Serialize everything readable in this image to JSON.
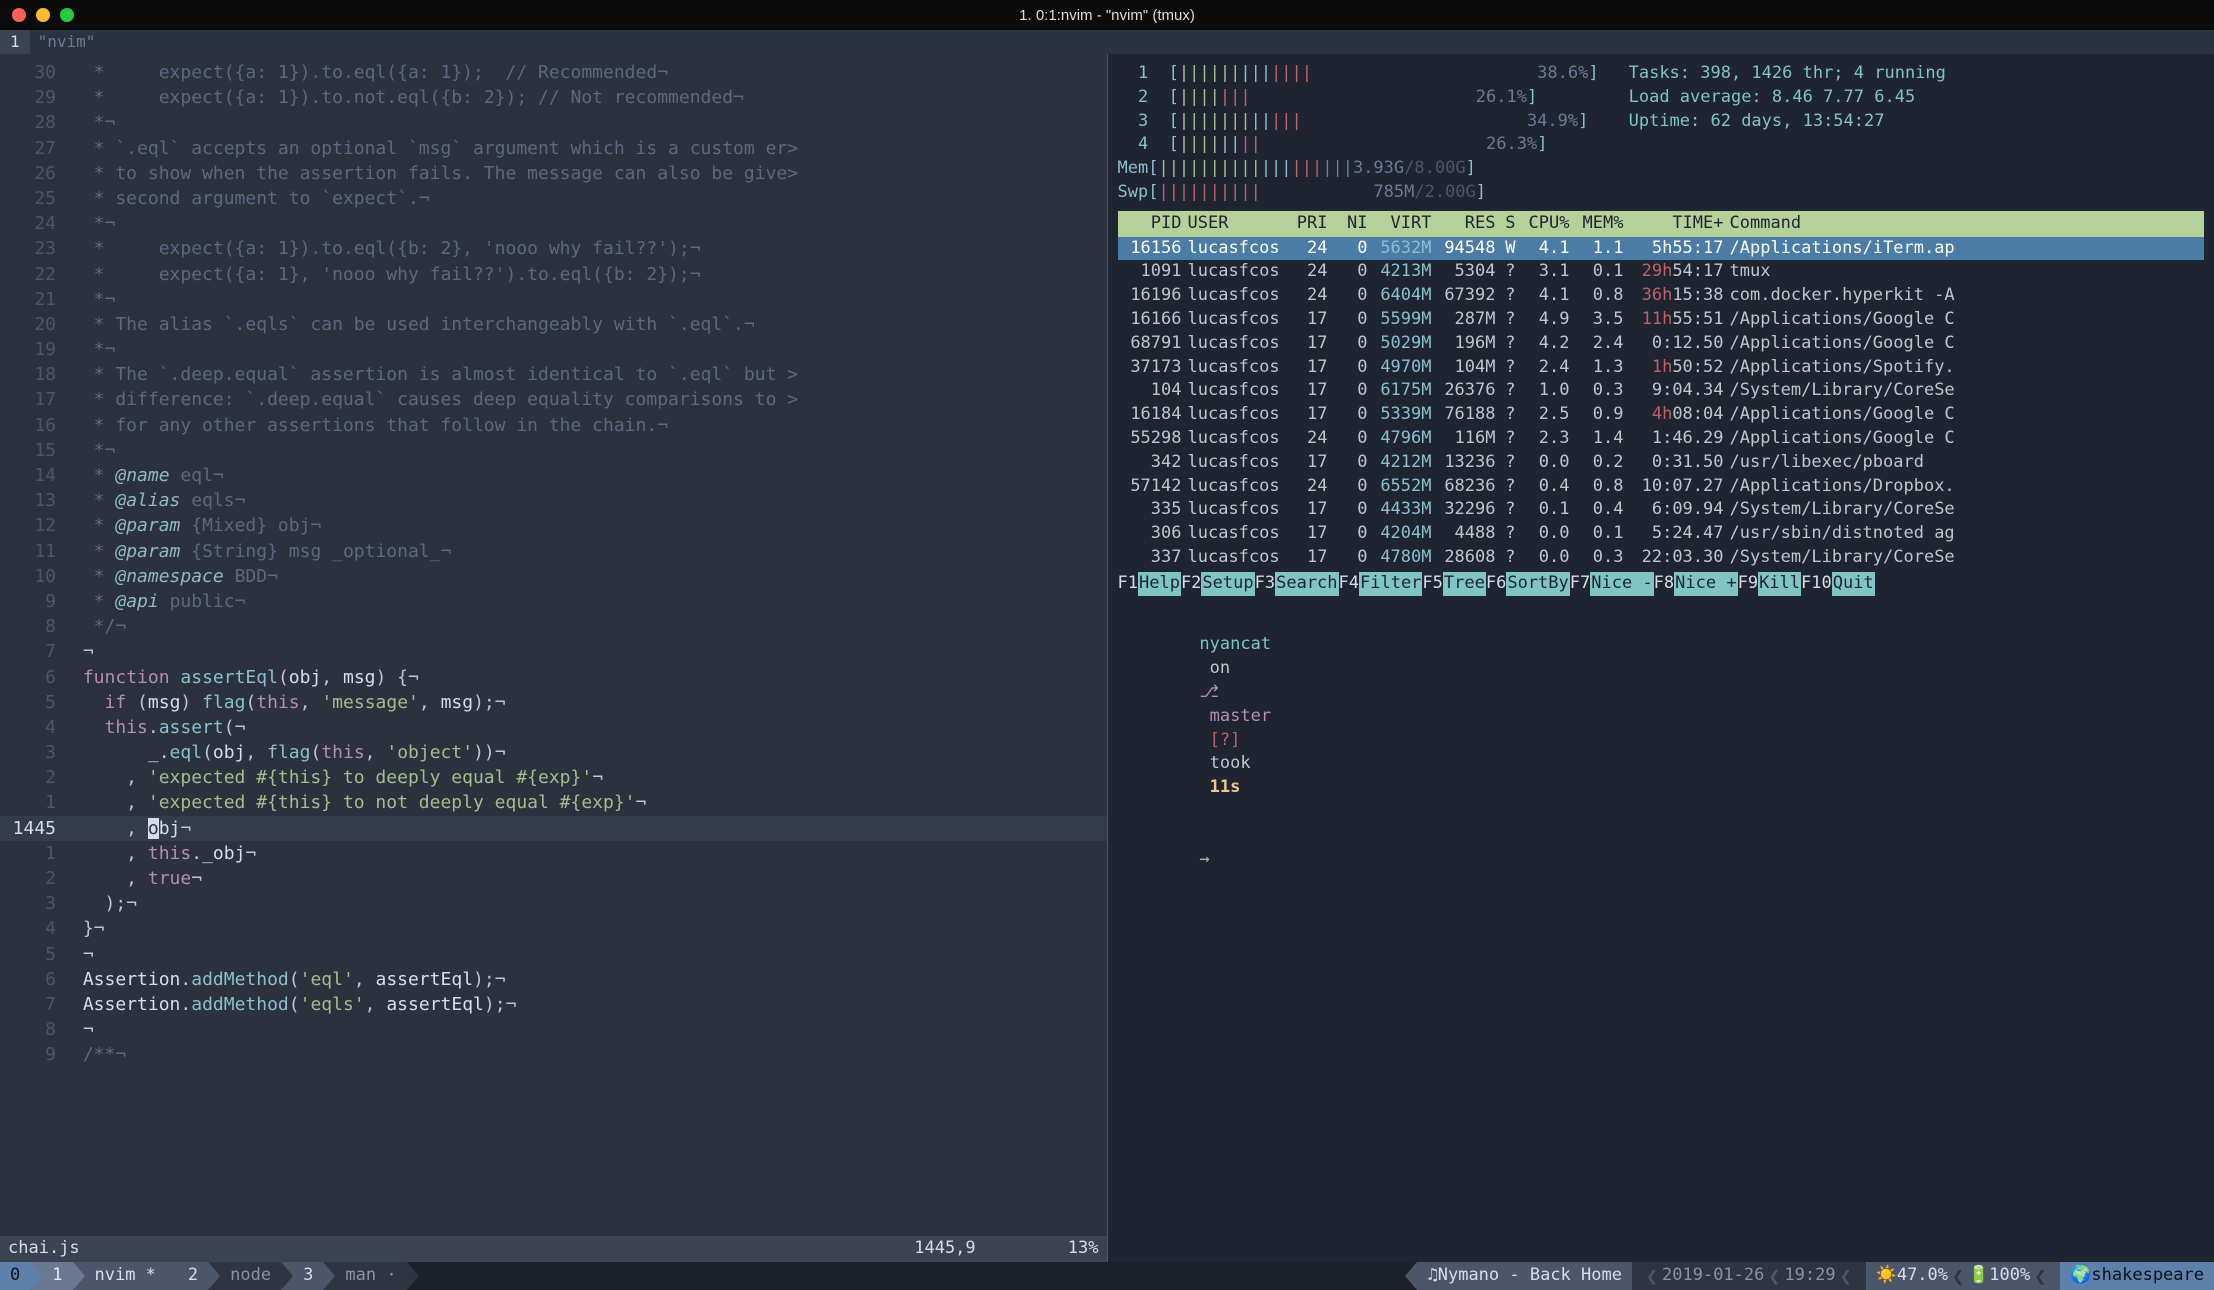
{
  "window": {
    "title": "1. 0:1:nvim - \"nvim\" (tmux)"
  },
  "tmux_tabs": {
    "index": "1",
    "label": "\"nvim\""
  },
  "editor": {
    "filename": "chai.js",
    "cursor_pos": "1445,9",
    "scroll_pct": "13%",
    "current_line_number": "1445",
    "lines": [
      {
        "n": "30",
        "cls": "dim",
        "html": "  *     expect({a: 1}).to.eql({a: 1});  // Recommended¬"
      },
      {
        "n": "29",
        "cls": "dim",
        "html": "  *     expect({a: 1}).to.not.eql({b: 2}); // Not recommended¬"
      },
      {
        "n": "28",
        "cls": "dim",
        "html": "  *¬"
      },
      {
        "n": "27",
        "cls": "dim",
        "html": "  * `.eql` accepts an optional `msg` argument which is a custom er>"
      },
      {
        "n": "26",
        "cls": "dim",
        "html": "  * to show when the assertion fails. The message can also be give>"
      },
      {
        "n": "25",
        "cls": "dim",
        "html": "  * second argument to `expect`.¬"
      },
      {
        "n": "24",
        "cls": "dim",
        "html": "  *¬"
      },
      {
        "n": "23",
        "cls": "dim",
        "html": "  *     expect({a: 1}).to.eql({b: 2}, 'nooo why fail??');¬"
      },
      {
        "n": "22",
        "cls": "dim",
        "html": "  *     expect({a: 1}, 'nooo why fail??').to.eql({b: 2});¬"
      },
      {
        "n": "21",
        "cls": "dim",
        "html": "  *¬"
      },
      {
        "n": "20",
        "cls": "dim",
        "html": "  * The alias `.eqls` can be used interchangeably with `.eql`.¬"
      },
      {
        "n": "19",
        "cls": "dim",
        "html": "  *¬"
      },
      {
        "n": "18",
        "cls": "dim",
        "html": "  * The `.deep.equal` assertion is almost identical to `.eql` but >"
      },
      {
        "n": "17",
        "cls": "dim",
        "html": "  * difference: `.deep.equal` causes deep equality comparisons to >"
      },
      {
        "n": "16",
        "cls": "dim",
        "html": "  * for any other assertions that follow in the chain.¬"
      },
      {
        "n": "15",
        "cls": "dim",
        "html": "  *¬"
      },
      {
        "n": "14",
        "cls": "tag",
        "html": "  * <span class='c-tag'>@name</span> <span class='c-dim'>eql</span>¬"
      },
      {
        "n": "13",
        "cls": "tag",
        "html": "  * <span class='c-tag'>@alias</span> <span class='c-dim'>eqls</span>¬"
      },
      {
        "n": "12",
        "cls": "tag",
        "html": "  * <span class='c-tag'>@param</span> <span class='c-dim'>{Mixed} obj</span>¬"
      },
      {
        "n": "11",
        "cls": "tag",
        "html": "  * <span class='c-tag'>@param</span> <span class='c-dim'>{String} msg _optional_</span>¬"
      },
      {
        "n": "10",
        "cls": "tag",
        "html": "  * <span class='c-tag'>@namespace</span> <span class='c-dim'>BDD</span>¬"
      },
      {
        "n": "9",
        "cls": "tag",
        "html": "  * <span class='c-tag'>@api</span> <span class='c-dim'>public</span>¬"
      },
      {
        "n": "8",
        "cls": "dim",
        "html": "  */¬"
      },
      {
        "n": "7",
        "cls": "code",
        "html": " ¬"
      },
      {
        "n": "6",
        "cls": "code",
        "html": " <span class='c-keyword'>function</span> <span class='c-func'>assertEql</span>(<span class='c-ident'>obj</span>, <span class='c-ident'>msg</span>) {¬"
      },
      {
        "n": "5",
        "cls": "code",
        "html": "   <span class='c-keyword'>if</span> (<span class='c-ident'>msg</span>) <span class='c-func'>flag</span>(<span class='c-keyword'>this</span>, <span class='c-string'>'message'</span>, <span class='c-ident'>msg</span>);¬"
      },
      {
        "n": "4",
        "cls": "code",
        "html": "   <span class='c-keyword'>this</span>.<span class='c-func'>assert</span>(¬"
      },
      {
        "n": "3",
        "cls": "code",
        "html": "       <span class='c-ident'>_</span>.<span class='c-func'>eql</span>(<span class='c-ident'>obj</span>, <span class='c-func'>flag</span>(<span class='c-keyword'>this</span>, <span class='c-string'>'object'</span>))¬"
      },
      {
        "n": "2",
        "cls": "code",
        "html": "     , <span class='c-string'>'expected #{this} to deeply equal #{exp}'</span>¬"
      },
      {
        "n": "1",
        "cls": "code",
        "html": "     , <span class='c-string'>'expected #{this} to not deeply equal #{exp}'</span>¬"
      },
      {
        "n": "1445",
        "cls": "cur",
        "html": "     , <span class='cursor-cell'>o</span><span class='c-ident'>bj</span>¬"
      },
      {
        "n": "1",
        "cls": "code",
        "html": "     , <span class='c-keyword'>this</span>.<span class='c-ident'>_obj</span>¬"
      },
      {
        "n": "2",
        "cls": "code",
        "html": "     , <span class='c-keyword'>true</span>¬"
      },
      {
        "n": "3",
        "cls": "code",
        "html": "   );¬"
      },
      {
        "n": "4",
        "cls": "code",
        "html": " }¬"
      },
      {
        "n": "5",
        "cls": "code",
        "html": " ¬"
      },
      {
        "n": "6",
        "cls": "code",
        "html": " <span class='c-ident'>Assertion</span>.<span class='c-func'>addMethod</span>(<span class='c-string'>'eql'</span>, <span class='c-ident'>assertEql</span>);¬"
      },
      {
        "n": "7",
        "cls": "code",
        "html": " <span class='c-ident'>Assertion</span>.<span class='c-func'>addMethod</span>(<span class='c-string'>'eqls'</span>, <span class='c-ident'>assertEql</span>);¬"
      },
      {
        "n": "8",
        "cls": "code",
        "html": " ¬"
      },
      {
        "n": "9",
        "cls": "dim",
        "html": " /**¬"
      }
    ]
  },
  "htop": {
    "cpus": [
      {
        "label": "1",
        "pct": "38.6%"
      },
      {
        "label": "2",
        "pct": "26.1%"
      },
      {
        "label": "3",
        "pct": "34.9%"
      },
      {
        "label": "4",
        "pct": "26.3%"
      }
    ],
    "mem": {
      "label": "Mem",
      "used": "3.93G",
      "total": "8.00G"
    },
    "swp": {
      "label": "Swp",
      "used": "785M",
      "total": "2.00G"
    },
    "tasks": "Tasks: 398, 1426 thr; 4 running",
    "load": "Load average: 8.46 7.77 6.45",
    "uptime": "Uptime: 62 days, 13:54:27",
    "headers": {
      "PID": "PID",
      "USER": "USER",
      "PRI": "PRI",
      "NI": "NI",
      "VIRT": "VIRT",
      "RES": "RES",
      "S": "S",
      "CPU": "CPU%",
      "MEM": "MEM%",
      "TIME": "TIME+",
      "CMD": "Command"
    },
    "rows": [
      {
        "sel": true,
        "PID": "16156",
        "USER": "lucasfcos",
        "PRI": "24",
        "NI": "0",
        "VIRT": "5632M",
        "RES": "94548",
        "S": "W",
        "CPU": "4.1",
        "MEM": "1.1",
        "TIMEh": "5h",
        "TIMEr": "55:17",
        "CMD": "/Applications/iTerm.ap"
      },
      {
        "PID": "1091",
        "USER": "lucasfcos",
        "PRI": "24",
        "NI": "0",
        "VIRT": "4213M",
        "RES": "5304",
        "S": "?",
        "CPU": "3.1",
        "MEM": "0.1",
        "TIMEh": "29h",
        "TIMEr": "54:17",
        "thl": "red",
        "CMD": "tmux"
      },
      {
        "PID": "16196",
        "USER": "lucasfcos",
        "PRI": "24",
        "NI": "0",
        "VIRT": "6404M",
        "RES": "67392",
        "S": "?",
        "CPU": "4.1",
        "MEM": "0.8",
        "TIMEh": "36h",
        "TIMEr": "15:38",
        "thl": "red",
        "CMD": "com.docker.hyperkit -A"
      },
      {
        "PID": "16166",
        "USER": "lucasfcos",
        "PRI": "17",
        "NI": "0",
        "VIRT": "5599M",
        "RES": "287M",
        "S": "?",
        "CPU": "4.9",
        "MEM": "3.5",
        "TIMEh": "11h",
        "TIMEr": "55:51",
        "thl": "red",
        "CMD": "/Applications/Google C"
      },
      {
        "PID": "68791",
        "USER": "lucasfcos",
        "PRI": "17",
        "NI": "0",
        "VIRT": "5029M",
        "RES": "196M",
        "S": "?",
        "CPU": "4.2",
        "MEM": "2.4",
        "TIMEh": "",
        "TIMEr": "0:12.50",
        "CMD": "/Applications/Google C"
      },
      {
        "PID": "37173",
        "USER": "lucasfcos",
        "PRI": "17",
        "NI": "0",
        "VIRT": "4970M",
        "RES": "104M",
        "S": "?",
        "CPU": "2.4",
        "MEM": "1.3",
        "TIMEh": "1h",
        "TIMEr": "50:52",
        "thl": "red",
        "CMD": "/Applications/Spotify."
      },
      {
        "PID": "104",
        "USER": "lucasfcos",
        "PRI": "17",
        "NI": "0",
        "VIRT": "6175M",
        "RES": "26376",
        "S": "?",
        "CPU": "1.0",
        "MEM": "0.3",
        "TIMEh": "",
        "TIMEr": "9:04.34",
        "CMD": "/System/Library/CoreSe"
      },
      {
        "PID": "16184",
        "USER": "lucasfcos",
        "PRI": "17",
        "NI": "0",
        "VIRT": "5339M",
        "RES": "76188",
        "S": "?",
        "CPU": "2.5",
        "MEM": "0.9",
        "TIMEh": "4h",
        "TIMEr": "08:04",
        "thl": "red",
        "CMD": "/Applications/Google C"
      },
      {
        "PID": "55298",
        "USER": "lucasfcos",
        "PRI": "24",
        "NI": "0",
        "VIRT": "4796M",
        "RES": "116M",
        "S": "?",
        "CPU": "2.3",
        "MEM": "1.4",
        "TIMEh": "",
        "TIMEr": "1:46.29",
        "CMD": "/Applications/Google C"
      },
      {
        "PID": "342",
        "USER": "lucasfcos",
        "PRI": "17",
        "NI": "0",
        "VIRT": "4212M",
        "RES": "13236",
        "S": "?",
        "CPU": "0.0",
        "MEM": "0.2",
        "TIMEh": "",
        "TIMEr": "0:31.50",
        "CMD": "/usr/libexec/pboard"
      },
      {
        "PID": "57142",
        "USER": "lucasfcos",
        "PRI": "24",
        "NI": "0",
        "VIRT": "6552M",
        "RES": "68236",
        "S": "?",
        "CPU": "0.4",
        "MEM": "0.8",
        "TIMEh": "",
        "TIMEr": "10:07.27",
        "CMD": "/Applications/Dropbox."
      },
      {
        "PID": "335",
        "USER": "lucasfcos",
        "PRI": "17",
        "NI": "0",
        "VIRT": "4433M",
        "RES": "32296",
        "S": "?",
        "CPU": "0.1",
        "MEM": "0.4",
        "TIMEh": "",
        "TIMEr": "6:09.94",
        "CMD": "/System/Library/CoreSe"
      },
      {
        "PID": "306",
        "USER": "lucasfcos",
        "PRI": "17",
        "NI": "0",
        "VIRT": "4204M",
        "RES": "4488",
        "S": "?",
        "CPU": "0.0",
        "MEM": "0.1",
        "TIMEh": "",
        "TIMEr": "5:24.47",
        "CMD": "/usr/sbin/distnoted ag"
      },
      {
        "PID": "337",
        "USER": "lucasfcos",
        "PRI": "17",
        "NI": "0",
        "VIRT": "4780M",
        "RES": "28608",
        "S": "?",
        "CPU": "0.0",
        "MEM": "0.3",
        "TIMEh": "",
        "TIMEr": "22:03.30",
        "CMD": "/System/Library/CoreSe"
      }
    ],
    "fkeys": [
      {
        "f": "F1",
        "l": "Help "
      },
      {
        "f": "F2",
        "l": "Setup "
      },
      {
        "f": "F3",
        "l": "Search"
      },
      {
        "f": "F4",
        "l": "Filter"
      },
      {
        "f": "F5",
        "l": "Tree  "
      },
      {
        "f": "F6",
        "l": "SortBy"
      },
      {
        "f": "F7",
        "l": "Nice -"
      },
      {
        "f": "F8",
        "l": "Nice +"
      },
      {
        "f": "F9",
        "l": "Kill  "
      },
      {
        "f": "F10",
        "l": "Quit"
      }
    ]
  },
  "shell": {
    "dir": "nyancat",
    "on": "on",
    "branchicon": "⎇",
    "branch": "master",
    "query": "[?]",
    "took": "took",
    "duration": "11s",
    "arrow": "→"
  },
  "tmux_status": {
    "session": "0",
    "windows": [
      {
        "i": "1",
        "n": "nvim *",
        "active": true
      },
      {
        "i": "2",
        "n": "node"
      },
      {
        "i": "3",
        "n": "man ·"
      }
    ],
    "music": "♫ Nymano - Back Home",
    "date": "2019-01-26",
    "time": "19:29",
    "weather": "☀️ 47.0%",
    "battery": "🔋 100%",
    "host": "shakespeare"
  }
}
